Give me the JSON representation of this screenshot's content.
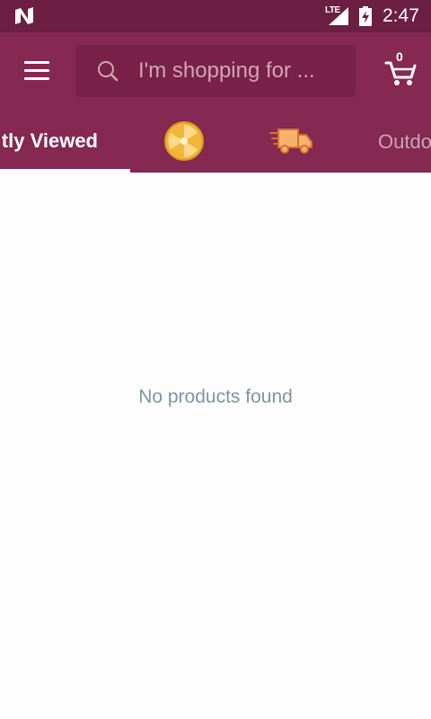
{
  "status_bar": {
    "network_type": "LTE",
    "time": "2:47",
    "icons": [
      "n-logo-icon",
      "signal-icon",
      "battery-charging-icon"
    ]
  },
  "toolbar": {
    "search": {
      "placeholder": "I'm shopping for ..."
    },
    "cart": {
      "count": "0",
      "icon": "cart-icon"
    },
    "menu_icon": "hamburger-menu-icon"
  },
  "tabs": [
    {
      "label": "Recently Viewed",
      "visible_text": "tly Viewed",
      "selected": true
    },
    {
      "icon": "deals-badge-icon",
      "selected": false
    },
    {
      "icon": "fast-delivery-truck-icon",
      "selected": false
    },
    {
      "label": "Outdoor",
      "visible_text": "Outdo",
      "selected": false
    }
  ],
  "main": {
    "empty_message": "No products found"
  },
  "colors": {
    "status_bar": "#6b1f42",
    "toolbar": "#852852",
    "search_box": "#7a2149",
    "empty_text": "#7d96a4",
    "deals_icon": "#f2b63a",
    "truck_icon": "#f5b26a"
  }
}
